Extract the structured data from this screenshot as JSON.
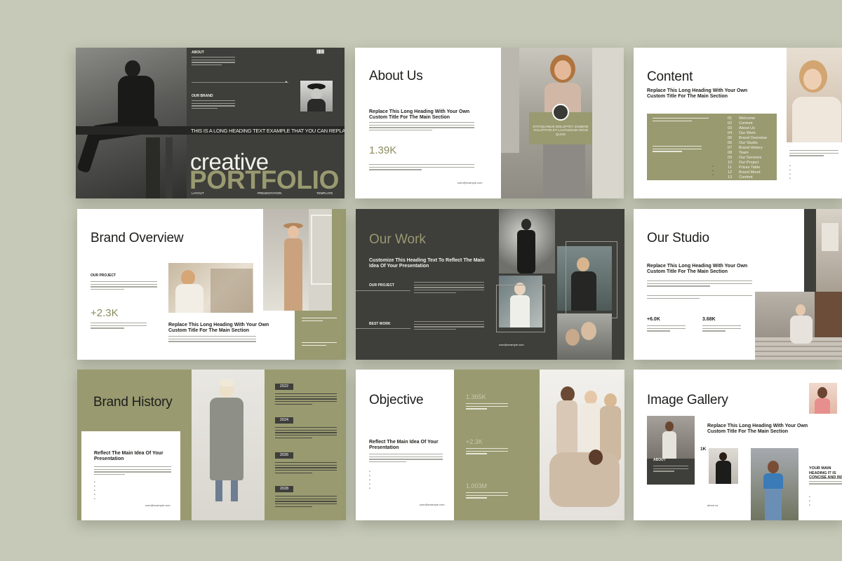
{
  "colors": {
    "background": "#c6c9b7",
    "dark": "#3e3e3b",
    "olive": "#999a70",
    "white": "#ffffff"
  },
  "slide1": {
    "about_label": "ABOUT",
    "brand_label": "OUR BRAND",
    "barcode_text": "||| |||| ||| ||",
    "ticker": "THIS IS A LONG HEADING TEXT EXAMPLE THAT YOU CAN REPLACE WITH YOUR",
    "title_a": "creative",
    "title_b": "PORTFOLIO",
    "footer": [
      "LAYOUT",
      "PRESENTATION",
      "TEMPLATE"
    ]
  },
  "slide2": {
    "title": "About Us",
    "heading": "Replace This Long Heading With Your Own Custom Title For The Main Section",
    "stat": "1.39K",
    "email": "user@example.com",
    "card_text": "STATQUAMUS MOLUPTET, EUMENE VOLUPTATE ET LAUTASSUM ARCID QUIAE"
  },
  "slide3": {
    "title": "Content",
    "heading": "Replace This Long Heading With Your Own Custom Title For The Main Section",
    "toc": [
      {
        "num": "01",
        "label": "Welcome"
      },
      {
        "num": "02",
        "label": "Content"
      },
      {
        "num": "03",
        "label": "About Us"
      },
      {
        "num": "04",
        "label": "Our Work"
      },
      {
        "num": "05",
        "label": "Brand Overview"
      },
      {
        "num": "06",
        "label": "Our Studio"
      },
      {
        "num": "07",
        "label": "Brand History"
      },
      {
        "num": "08",
        "label": "Team"
      },
      {
        "num": "09",
        "label": "Our Services"
      },
      {
        "num": "10",
        "label": "Our Project"
      },
      {
        "num": "11",
        "label": "Prices Table"
      },
      {
        "num": "12",
        "label": "Brand Mood"
      },
      {
        "num": "13",
        "label": "Content"
      }
    ]
  },
  "slide4": {
    "title": "Brand Overview",
    "project_label": "OUR PROJECT",
    "stat": "+2.3K",
    "heading": "Replace This Long Heading With Your Own Custom Title For The Main Section"
  },
  "slide5": {
    "title": "Our Work",
    "heading": "Customize This Heading Text To Reflect The Main Idea Of Your Presentation",
    "project_label": "OUR PROJECT",
    "best_label": "BEST WORK",
    "email": "user@example.com"
  },
  "slide6": {
    "title": "Our Studio",
    "heading": "Replace This Long Heading With Your Own Custom Title For The Main Section",
    "stat_a": "+6.0K",
    "stat_b": "3.68K"
  },
  "slide7": {
    "title": "Brand History",
    "heading": "Reflect The Main Idea Of Your Presentation",
    "years": [
      "2022",
      "2024",
      "2026",
      "2028"
    ],
    "email": "user@example.com"
  },
  "slide8": {
    "title": "Objective",
    "heading": "Reflect The Main Idea Of Your Presentation",
    "nums": [
      "1.365K",
      "+2.3K",
      "1.003M"
    ],
    "email": "user@example.com"
  },
  "slide9": {
    "title": "Image Gallery",
    "heading": "Replace This Long Heading With Your Own Custom Title For The Main Section",
    "about_label": "ABOUT",
    "stat": "1K",
    "side_heading": "YOUR MAIN HEADING IT IS CONCISE AND INS",
    "footer": "about us"
  }
}
